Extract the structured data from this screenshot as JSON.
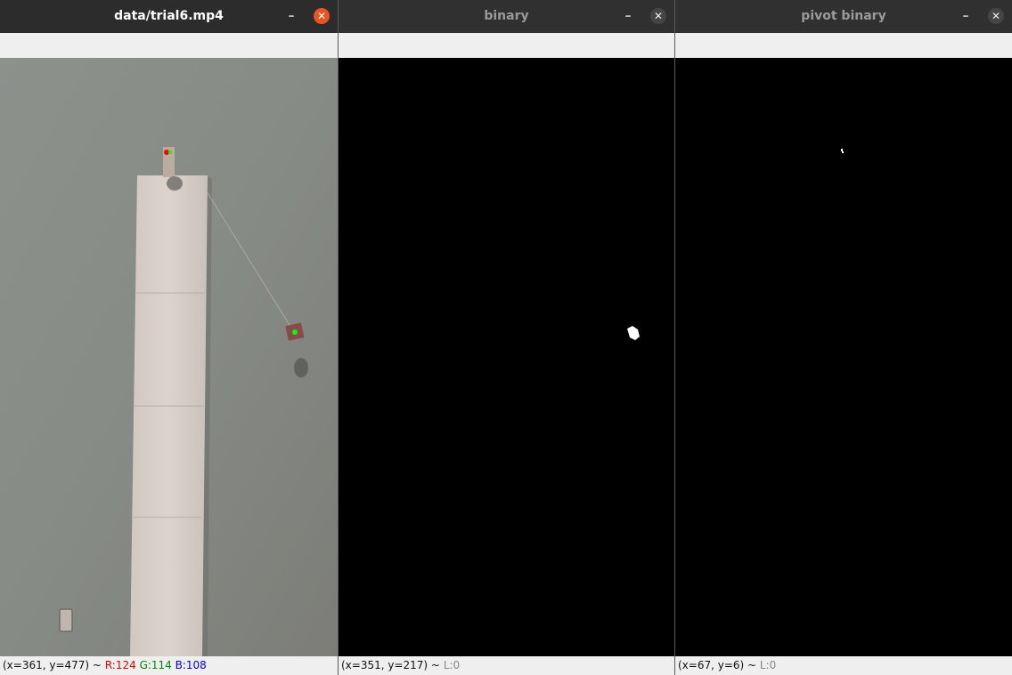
{
  "windows": [
    {
      "title": "data/trial6.mp4",
      "status": {
        "coords": "(x=361, y=477) ~",
        "r": "R:124",
        "g": "G:114",
        "b": "B:108"
      }
    },
    {
      "title": "binary",
      "status": {
        "coords": "(x=351, y=217) ~",
        "l": "L:0"
      }
    },
    {
      "title": "pivot binary",
      "status": {
        "coords": "(x=67, y=6) ~",
        "l": "L:0"
      }
    }
  ],
  "icons": {
    "minimize": "minimize-icon",
    "close": "close-icon"
  },
  "colors": {
    "status_r": "#e00000",
    "status_g": "#008800",
    "status_b": "#0000ee",
    "close_active": "#e95420",
    "marker_red": "#ff0000",
    "marker_green": "#00ff00"
  }
}
